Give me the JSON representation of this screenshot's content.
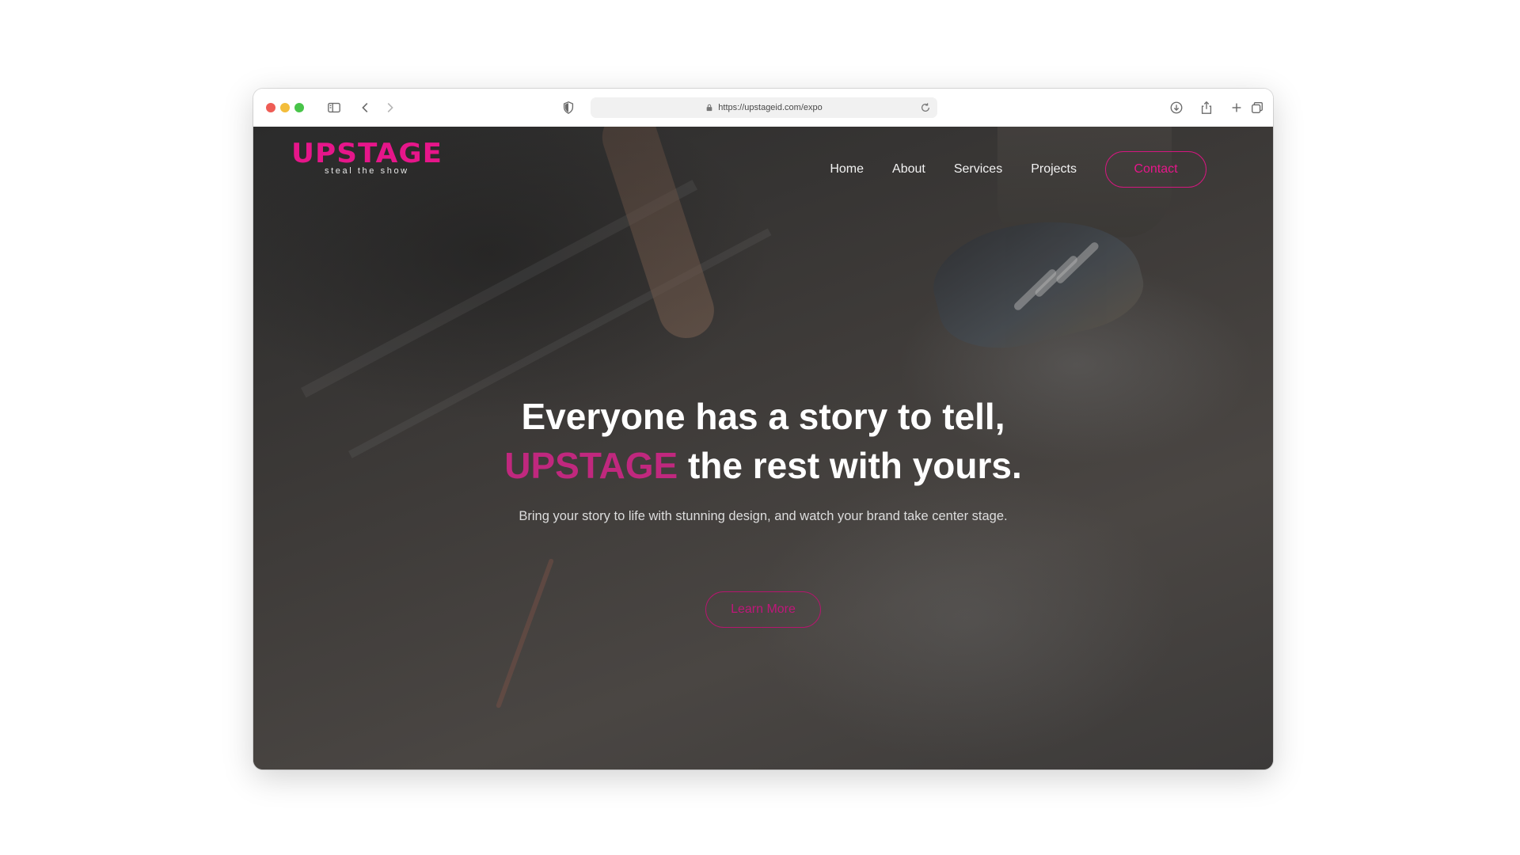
{
  "browser": {
    "url": "https://upstageid.com/expo"
  },
  "site": {
    "logo": {
      "name": "UPSTAGE",
      "tagline": "steal the show"
    },
    "nav": {
      "items": [
        {
          "label": "Home"
        },
        {
          "label": "About"
        },
        {
          "label": "Services"
        },
        {
          "label": "Projects"
        }
      ],
      "contact_label": "Contact"
    },
    "hero": {
      "line1": "Everyone has a story to tell,",
      "line2_accent": "UPSTAGE",
      "line2_rest": " the rest with yours.",
      "subtitle": "Bring your story to life with stunning design, and watch your brand take center stage.",
      "cta_label": "Learn More"
    },
    "colors": {
      "brand_pink": "#e6168a",
      "accent_text": "#c0287e",
      "overlay_dark": "#3a3a3a"
    }
  }
}
